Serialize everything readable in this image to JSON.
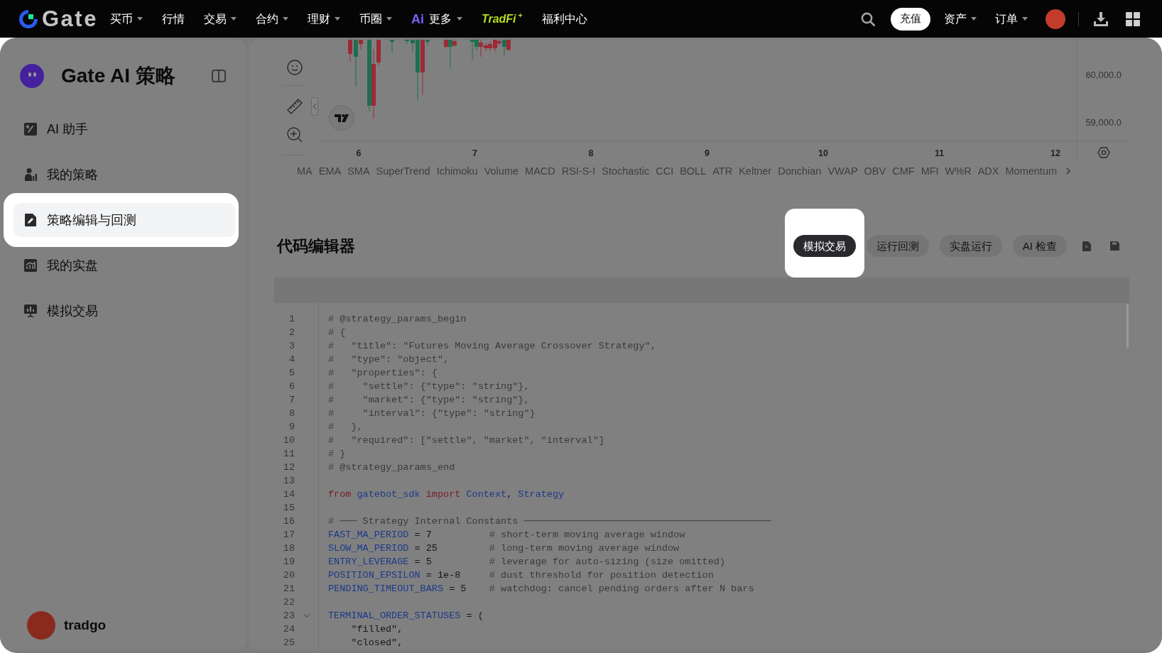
{
  "top_nav": {
    "logo": "Gate",
    "items": [
      {
        "kind": "plain",
        "label": "买币",
        "dropdown": true
      },
      {
        "kind": "plain",
        "label": "行情",
        "dropdown": false
      },
      {
        "kind": "plain",
        "label": "交易",
        "dropdown": true
      },
      {
        "kind": "plain",
        "label": "合约",
        "dropdown": true
      },
      {
        "kind": "plain",
        "label": "理财",
        "dropdown": true
      },
      {
        "kind": "plain",
        "label": "币圈",
        "dropdown": true
      },
      {
        "kind": "ai",
        "badge": "Ai",
        "label": "更多",
        "dropdown": true
      },
      {
        "kind": "tradfi",
        "label": "TradFi",
        "dropdown": false
      },
      {
        "kind": "plain",
        "label": "福利中心",
        "dropdown": false
      }
    ],
    "deposit_button": "充值",
    "account_menus": [
      {
        "label": "资产",
        "dropdown": true
      },
      {
        "label": "订单",
        "dropdown": true
      }
    ]
  },
  "sidebar": {
    "title": "Gate AI 策略",
    "items": [
      {
        "label": "AI 助手",
        "selected": false,
        "highlighted": false
      },
      {
        "label": "我的策略",
        "selected": false,
        "highlighted": false
      },
      {
        "label": "策略编辑与回测",
        "selected": true,
        "highlighted": true
      },
      {
        "label": "我的实盘",
        "selected": false,
        "highlighted": false
      },
      {
        "label": "模拟交易",
        "selected": false,
        "highlighted": false
      }
    ],
    "user": {
      "name": "tradgo"
    }
  },
  "chart": {
    "price_labels": [
      "60,000.0",
      "59,000.0"
    ],
    "time_labels": [
      "6",
      "7",
      "8",
      "9",
      "10",
      "11",
      "12"
    ],
    "indicators": [
      "MA",
      "EMA",
      "SMA",
      "SuperTrend",
      "Ichimoku",
      "Volume",
      "MACD",
      "RSI-S-I",
      "Stochastic",
      "CCI",
      "BOLL",
      "ATR",
      "Keltner",
      "Donchian",
      "VWAP",
      "OBV",
      "CMF",
      "MFI",
      "W%R",
      "ADX",
      "Momentum"
    ]
  },
  "editor": {
    "title": "代码编辑器",
    "actions": [
      {
        "label": "模拟交易",
        "primary": true,
        "highlighted": true
      },
      {
        "label": "运行回测",
        "primary": false,
        "highlighted": false
      },
      {
        "label": "实盘运行",
        "primary": false,
        "highlighted": false
      },
      {
        "label": "AI 检查",
        "primary": false,
        "highlighted": false
      }
    ],
    "lines": [
      {
        "number": "1",
        "foldable": false,
        "tokens": [
          {
            "kind": "comment",
            "text": "# @strategy_params_begin"
          }
        ]
      },
      {
        "number": "2",
        "foldable": false,
        "tokens": [
          {
            "kind": "comment",
            "text": "# {"
          }
        ]
      },
      {
        "number": "3",
        "foldable": false,
        "tokens": [
          {
            "kind": "comment",
            "text": "#   \"title\": \"Futures Moving Average Crossover Strategy\","
          }
        ]
      },
      {
        "number": "4",
        "foldable": false,
        "tokens": [
          {
            "kind": "comment",
            "text": "#   \"type\": \"object\","
          }
        ]
      },
      {
        "number": "5",
        "foldable": false,
        "tokens": [
          {
            "kind": "comment",
            "text": "#   \"properties\": {"
          }
        ]
      },
      {
        "number": "6",
        "foldable": false,
        "tokens": [
          {
            "kind": "comment",
            "text": "#     \"settle\": {\"type\": \"string\"},"
          }
        ]
      },
      {
        "number": "7",
        "foldable": false,
        "tokens": [
          {
            "kind": "comment",
            "text": "#     \"market\": {\"type\": \"string\"},"
          }
        ]
      },
      {
        "number": "8",
        "foldable": false,
        "tokens": [
          {
            "kind": "comment",
            "text": "#     \"interval\": {\"type\": \"string\"}"
          }
        ]
      },
      {
        "number": "9",
        "foldable": false,
        "tokens": [
          {
            "kind": "comment",
            "text": "#   },"
          }
        ]
      },
      {
        "number": "10",
        "foldable": false,
        "tokens": [
          {
            "kind": "comment",
            "text": "#   \"required\": [\"settle\", \"market\", \"interval\"]"
          }
        ]
      },
      {
        "number": "11",
        "foldable": false,
        "tokens": [
          {
            "kind": "comment",
            "text": "# }"
          }
        ]
      },
      {
        "number": "12",
        "foldable": false,
        "tokens": [
          {
            "kind": "comment",
            "text": "# @strategy_params_end"
          }
        ]
      },
      {
        "number": "13",
        "foldable": false
      },
      {
        "number": "14",
        "foldable": false,
        "tokens": [
          {
            "kind": "keyword",
            "text": "from"
          },
          {
            "kind": "name",
            "text": " gatebot_sdk"
          },
          {
            "kind": "keyword",
            "text": " import"
          },
          {
            "kind": "name",
            "text": " Context"
          },
          {
            "kind": "plain",
            "text": ","
          },
          {
            "kind": "name",
            "text": " Strategy"
          }
        ]
      },
      {
        "number": "15",
        "foldable": false
      },
      {
        "number": "16",
        "foldable": false,
        "tokens": [
          {
            "kind": "comment",
            "text": "# ─── Strategy Internal Constants ───────────────────────────────────────────"
          }
        ]
      },
      {
        "number": "17",
        "foldable": false,
        "tokens": [
          {
            "kind": "name",
            "text": "FAST_MA_PERIOD"
          },
          {
            "kind": "plain",
            "text": " = 7          "
          },
          {
            "kind": "comment",
            "text": "# short-term moving average window"
          }
        ]
      },
      {
        "number": "18",
        "foldable": false,
        "tokens": [
          {
            "kind": "name",
            "text": "SLOW_MA_PERIOD"
          },
          {
            "kind": "plain",
            "text": " = 25         "
          },
          {
            "kind": "comment",
            "text": "# long-term moving average window"
          }
        ]
      },
      {
        "number": "19",
        "foldable": false,
        "tokens": [
          {
            "kind": "name",
            "text": "ENTRY_LEVERAGE"
          },
          {
            "kind": "plain",
            "text": " = 5          "
          },
          {
            "kind": "comment",
            "text": "# leverage for auto-sizing (size omitted)"
          }
        ]
      },
      {
        "number": "20",
        "foldable": false,
        "tokens": [
          {
            "kind": "name",
            "text": "POSITION_EPSILON"
          },
          {
            "kind": "plain",
            "text": " = 1e-8     "
          },
          {
            "kind": "comment",
            "text": "# dust threshold for position detection"
          }
        ]
      },
      {
        "number": "21",
        "foldable": false,
        "tokens": [
          {
            "kind": "name",
            "text": "PENDING_TIMEOUT_BARS"
          },
          {
            "kind": "plain",
            "text": " = 5    "
          },
          {
            "kind": "comment",
            "text": "# watchdog: cancel pending orders after N bars"
          }
        ]
      },
      {
        "number": "22",
        "foldable": false
      },
      {
        "number": "23",
        "foldable": true,
        "tokens": [
          {
            "kind": "name",
            "text": "TERMINAL_ORDER_STATUSES"
          },
          {
            "kind": "plain",
            "text": " = ("
          }
        ]
      },
      {
        "number": "24",
        "foldable": false,
        "tokens": [
          {
            "kind": "plain",
            "text": "    \"filled\","
          }
        ]
      },
      {
        "number": "25",
        "foldable": false,
        "tokens": [
          {
            "kind": "plain",
            "text": "    \"closed\","
          }
        ]
      }
    ]
  }
}
